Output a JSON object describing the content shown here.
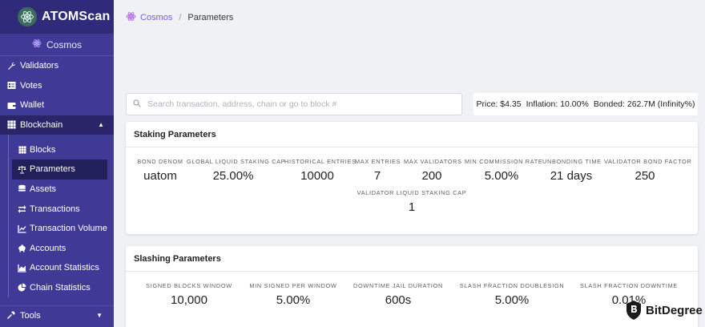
{
  "app": {
    "title": "ATOMScan",
    "chain": "Cosmos"
  },
  "sidebar": {
    "top_items": [
      {
        "label": "Validators",
        "icon": "wrench-icon"
      },
      {
        "label": "Votes",
        "icon": "ballot-icon"
      },
      {
        "label": "Wallet",
        "icon": "wallet-icon"
      }
    ],
    "blockchain": {
      "label": "Blockchain",
      "icon": "grid-icon",
      "expanded": true
    },
    "sub_items": [
      {
        "label": "Blocks",
        "icon": "grid-icon",
        "active": false
      },
      {
        "label": "Parameters",
        "icon": "scale-icon",
        "active": true
      },
      {
        "label": "Assets",
        "icon": "coins-icon",
        "active": false
      },
      {
        "label": "Transactions",
        "icon": "exchange-icon",
        "active": false
      },
      {
        "label": "Transaction Volume",
        "icon": "chart-line-icon",
        "active": false
      },
      {
        "label": "Accounts",
        "icon": "piggy-bank-icon",
        "active": false
      },
      {
        "label": "Account Statistics",
        "icon": "chart-area-icon",
        "active": false
      },
      {
        "label": "Chain Statistics",
        "icon": "pie-chart-icon",
        "active": false
      }
    ],
    "tools": {
      "label": "Tools",
      "icon": "tools-icon"
    }
  },
  "breadcrumb": {
    "root": "Cosmos",
    "separator": "/",
    "current": "Parameters"
  },
  "search": {
    "placeholder": "Search transaction, address, chain or go to block #",
    "value": ""
  },
  "market": {
    "price": "Price: $4.35",
    "inflation": "Inflation: 10.00%",
    "bonded": "Bonded: 262.7M (Infinity%)"
  },
  "staking": {
    "title": "Staking Parameters",
    "params": [
      {
        "label": "Bond Denom",
        "value": "uatom"
      },
      {
        "label": "Global Liquid Staking Cap",
        "value": "25.00%"
      },
      {
        "label": "Historical Entries",
        "value": "10000"
      },
      {
        "label": "Max Entries",
        "value": "7"
      },
      {
        "label": "Max Validators",
        "value": "200"
      },
      {
        "label": "Min Commission Rate",
        "value": "5.00%"
      },
      {
        "label": "Unbonding Time",
        "value": "21 days"
      },
      {
        "label": "Validator Bond Factor",
        "value": "250"
      },
      {
        "label": "Validator Liquid Staking Cap",
        "value": "1"
      }
    ]
  },
  "slashing": {
    "title": "Slashing Parameters",
    "params": [
      {
        "label": "Signed Blocks Window",
        "value": "10,000"
      },
      {
        "label": "Min Signed Per Window",
        "value": "5.00%"
      },
      {
        "label": "Downtime Jail Duration",
        "value": "600s"
      },
      {
        "label": "Slash Fraction Doublesign",
        "value": "5.00%"
      },
      {
        "label": "Slash Fraction Downtime",
        "value": "0.01%"
      }
    ]
  },
  "watermark": {
    "text": "BitDegree"
  },
  "colors": {
    "sidebar": "#3f3a96",
    "brand_bar": "#2f2b7a",
    "active": "#22205a",
    "accent": "#7b5bd6"
  }
}
